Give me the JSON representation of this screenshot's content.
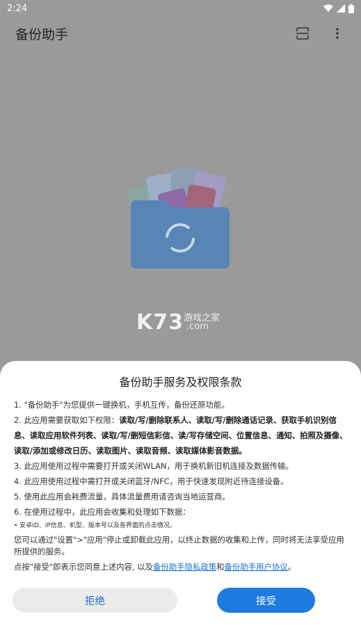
{
  "status": {
    "time": "2:24"
  },
  "appbar": {
    "title": "备份助手"
  },
  "watermark": {
    "logo": "K73",
    "sub_cn": "游戏之家",
    "sub_com": ".com"
  },
  "dialog": {
    "title": "备份助手服务及权限条款",
    "items": {
      "i1": "1. \"备份助手\"为您提供一键换机，手机互传，备份还原功能。",
      "i2_prefix": "2. 此应用需要获取如下权限：",
      "i2_bold": "读取/写/删除联系人、读取/写/删除通话记录、获取手机识别信息、读取应用软件列表、读取/写/删短信彩信、读/写存储空间、位置信息、通知、拍照及摄像、读取/添加或修改日历、读取图片、读取音频、读取媒体影音数据。",
      "i3": "3. 此应用使用过程中需要打开或关闭WLAN，用于换机新旧机连接及数据传输。",
      "i4": "4. 此应用使用过程中需打开或关闭蓝牙/NFC，用于快速发现附近待连接设备。",
      "i5": "5. 使用此应用会耗费流量，具体流量费用请咨询当地运营商。",
      "i6": "6. 在使用过程中，此应用会收集和处理如下数据：",
      "i6_sub": "• 安卓ID、IP信息、机型、版本号以及各界面的点击情况。",
      "uninstall": "您可以通过\"设置\">\"应用\"停止或卸载此应用，以终止数据的收集和上传，同时将无法享受应用所提供的服务。",
      "consent_prefix": "点按\"接受\"即表示您同意上述内容, 以及",
      "privacy_link": "备份助手隐私政策",
      "consent_and": "和",
      "agreement_link": "备份助手用户协议",
      "consent_suffix": "。"
    },
    "reject_label": "拒绝",
    "accept_label": "接受"
  },
  "colors": {
    "accent": "#1f7ae0",
    "link": "#1d6fd6",
    "reject_bg": "#ebebeb"
  }
}
